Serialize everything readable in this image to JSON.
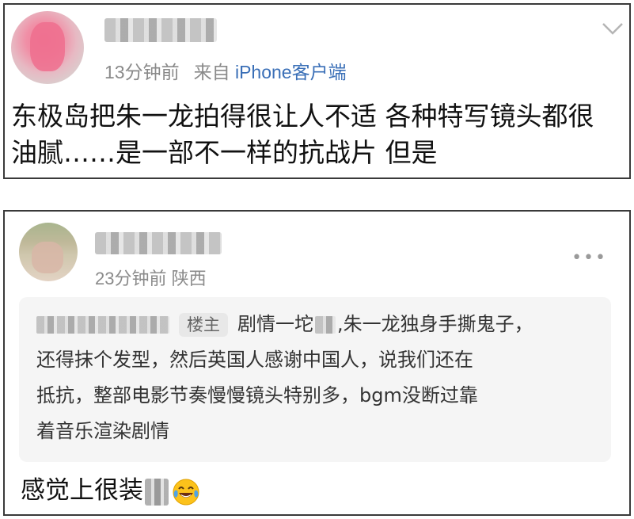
{
  "post": {
    "time": "13分钟前",
    "source_prefix": "来自",
    "source_client": "iPhone客户端",
    "text_line1": "东极岛把朱一龙拍得很让人不适 各种特写镜头都很",
    "text_line2": "油腻……是一部不一样的抗战片 但是"
  },
  "comment": {
    "time": "23分钟前",
    "location": "陕西",
    "reply": {
      "badge": "楼主",
      "part1": "剧情一坨",
      "part2": ",朱一龙独身手撕鬼子，",
      "line2": "还得抹个发型，然后英国人感谢中国人，说我们还在",
      "line3": "抵抗，整部电影节奏慢慢镜头特别多，bgm没断过靠",
      "line4": "着音乐渲染剧情"
    },
    "text": "感觉上很装"
  },
  "icons": {
    "post_menu": "chevron-down-icon",
    "comment_menu": "more-dots-icon",
    "emoji": "laughing-tears-emoji-icon"
  },
  "colors": {
    "client_link": "#3a6fb7",
    "meta_gray": "#8a8a8a",
    "reply_bg": "#f5f5f5"
  }
}
